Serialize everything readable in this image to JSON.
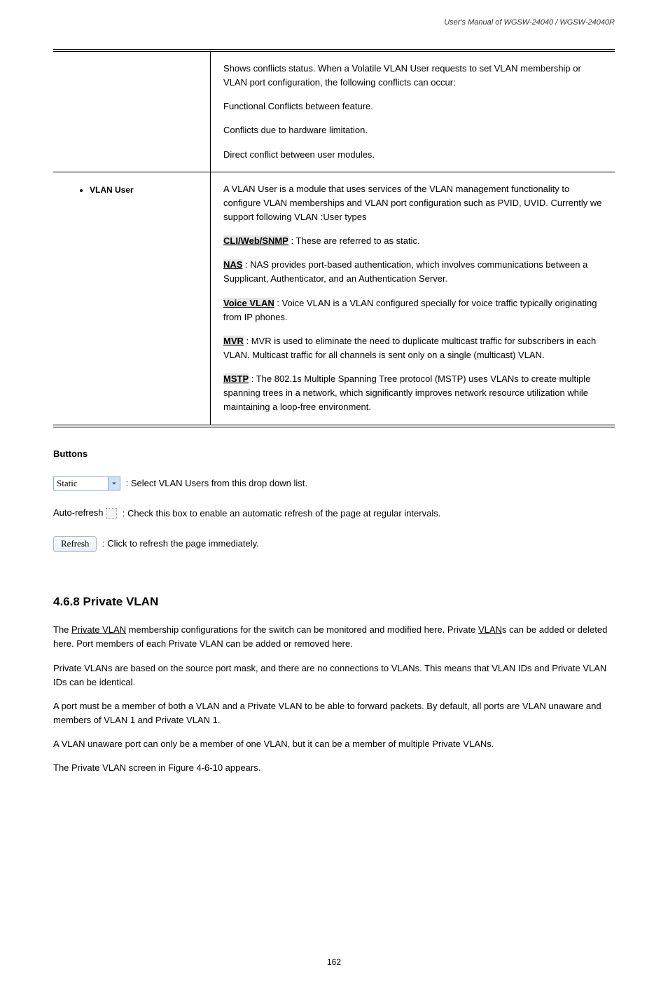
{
  "manual_header": "User's Manual of WGSW-24040 / WGSW-24040R",
  "table": {
    "row_hidden": {
      "desc1_prefix": "Shows conflicts status. When a Volatile VLAN User requests to set VLAN membership or VLAN port configuration, the following conflicts can occur:",
      "desc2": "Functional Conflicts between feature.",
      "desc3": "Conflicts due to hardware limitation.",
      "desc4": "Direct conflict between user modules."
    },
    "row_user": {
      "label": "VLAN User",
      "p1": "A VLAN User is a module that uses services of the VLAN management functionality to configure VLAN memberships and VLAN port configuration such as PVID, UVID. Currently we support following VLAN :User types",
      "cli_label": "CLI/Web/SNMP",
      "cli_desc": " : These are referred to as static.",
      "nas_label": "NAS",
      "nas_desc": " : NAS provides port-based authentication, which involves communications between a Supplicant, Authenticator, and an Authentication Server.",
      "voice_label": "Voice VLAN",
      "voice_desc": " : Voice VLAN is a VLAN configured specially for voice traffic typically originating from IP phones.",
      "mvr_label": "MVR",
      "mvr_desc": " : MVR is used to eliminate the need to duplicate multicast traffic for subscribers in each VLAN. Multicast traffic for all channels is sent only on a single (multicast) VLAN.",
      "mstp_label": "MSTP",
      "mstp_desc": " : The 802.1s Multiple Spanning Tree protocol (MSTP) uses VLANs to create multiple spanning trees in a network, which significantly improves network resource utilization while maintaining a loop-free environment."
    }
  },
  "buttons_heading": "Buttons",
  "select_value": "Static",
  "select_after": ": Select VLAN Users from this drop down list.",
  "autorefresh_label": "Auto-refresh",
  "autorefresh_after": ": Check this box to enable an automatic refresh of the page at regular intervals.",
  "refresh_label": "Refresh",
  "refresh_after": ": Click to refresh the page immediately.",
  "section_heading": "4.6.8 Private VLAN",
  "section_p1_a": "The ",
  "section_p1_link": "Private VLAN",
  "section_p1_b": " membership configurations for the switch can be monitored and modified here. Private ",
  "section_p1_link2": "VLAN",
  "section_p1_c": "s can be added or deleted here. Port members of each Private VLAN can be added or removed here.",
  "section_p2": "Private VLANs are based on the source port mask, and there are no connections to VLANs. This means that VLAN IDs and Private VLAN IDs can be identical.",
  "section_p3": "A port must be a member of both a VLAN and a Private VLAN to be able to forward packets. By default, all ports are VLAN unaware and members of VLAN 1 and Private VLAN 1.",
  "section_p4": "A VLAN unaware port can only be a member of one VLAN, but it can be a member of multiple Private VLANs.",
  "section_p5": "The Private VLAN screen in Figure 4-6-10 appears.",
  "page_number": "162"
}
